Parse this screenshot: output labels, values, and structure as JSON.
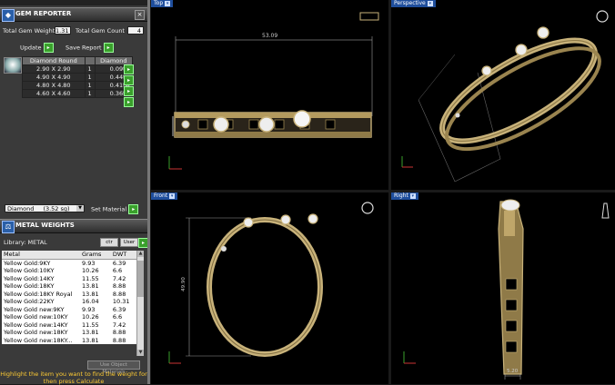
{
  "gem_reporter": {
    "title": "GEM REPORTER",
    "total_weight_label": "Total Gem Weight",
    "total_weight_value": "1.31",
    "total_count_label": "Total Gem Count",
    "total_count_value": "4",
    "update_label": "Update",
    "save_report_label": "Save Report",
    "table_headers": [
      "Diamond Round",
      "",
      "Diamond"
    ],
    "rows": [
      {
        "size": "2.90 X 2.90",
        "qty": "1",
        "weight": "0.09tw"
      },
      {
        "size": "4.90 X 4.90",
        "qty": "1",
        "weight": "0.44tw"
      },
      {
        "size": "4.80 X 4.80",
        "qty": "1",
        "weight": "0.41tw"
      },
      {
        "size": "4.60 X 4.60",
        "qty": "1",
        "weight": "0.36tw"
      }
    ],
    "material_select": "Diamond",
    "material_sg": "(3.52 sg)",
    "set_material_label": "Set Material"
  },
  "metal_weights": {
    "title": "METAL WEIGHTS",
    "library_label": "Library: METAL",
    "btn1": "ctr",
    "btn2": "User",
    "headers": [
      "Metal",
      "Grams",
      "DWT"
    ],
    "rows": [
      {
        "metal": "Yellow Gold:9KY",
        "grams": "9.93",
        "dwt": "6.39"
      },
      {
        "metal": "Yellow Gold:10KY",
        "grams": "10.26",
        "dwt": "6.6"
      },
      {
        "metal": "Yellow Gold:14KY",
        "grams": "11.55",
        "dwt": "7.42"
      },
      {
        "metal": "Yellow Gold:18KY",
        "grams": "13.81",
        "dwt": "8.88"
      },
      {
        "metal": "Yellow Gold:18KY Royal",
        "grams": "13.81",
        "dwt": "8.88"
      },
      {
        "metal": "Yellow Gold:22KY",
        "grams": "16.04",
        "dwt": "10.31"
      },
      {
        "metal": "Yellow Gold new:9KY",
        "grams": "9.93",
        "dwt": "6.39"
      },
      {
        "metal": "Yellow Gold new:10KY",
        "grams": "10.26",
        "dwt": "6.6"
      },
      {
        "metal": "Yellow Gold new:14KY",
        "grams": "11.55",
        "dwt": "7.42"
      },
      {
        "metal": "Yellow Gold new:18KY",
        "grams": "13.81",
        "dwt": "8.88"
      },
      {
        "metal": "Yellow Gold new:18KY...",
        "grams": "13.81",
        "dwt": "8.88"
      }
    ],
    "use_object_materials": "Use Object Materials",
    "hint": "Highlight the item you want to find the weight for then press Calculate"
  },
  "viewports": {
    "top": {
      "label": "Top",
      "dimension": "53.09"
    },
    "perspective": {
      "label": "Perspective"
    },
    "front": {
      "label": "Front",
      "dimension": "49.90"
    },
    "right": {
      "label": "Right",
      "dimension": "5.20"
    }
  },
  "colors": {
    "accent": "#1f4e9c",
    "gold": "#c8b27a",
    "green_button": "#3aa02c"
  }
}
